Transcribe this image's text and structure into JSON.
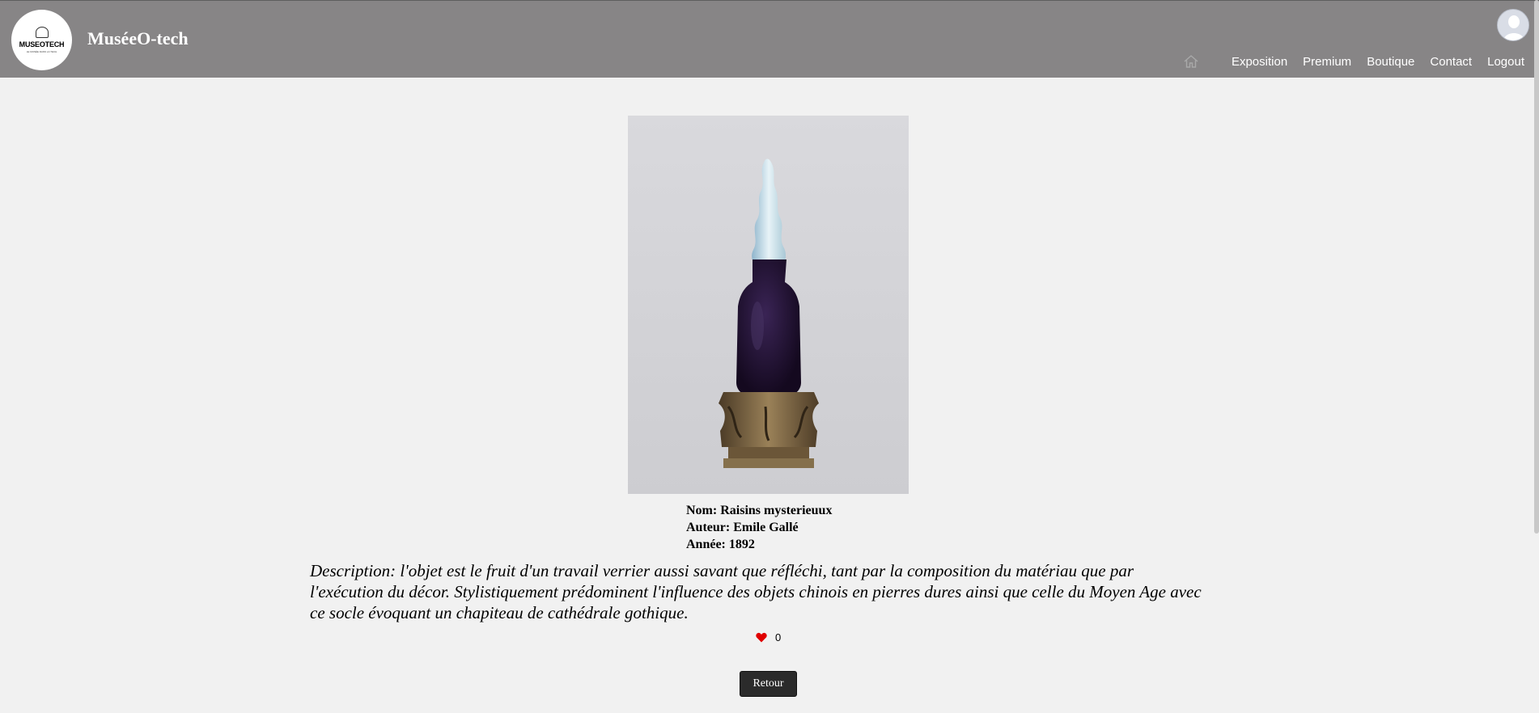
{
  "header": {
    "logo": {
      "text": "MUSEOTECH",
      "subtext": "LE MUSÉE DANS LA TECH"
    },
    "site_title": "MuséeO-tech",
    "nav": {
      "home_icon": "home-icon",
      "items": [
        {
          "label": "Exposition"
        },
        {
          "label": "Premium"
        },
        {
          "label": "Boutique"
        },
        {
          "label": "Contact"
        },
        {
          "label": "Logout"
        }
      ]
    },
    "avatar_icon": "user-avatar-icon"
  },
  "artwork": {
    "image_icon": "vase-artwork-image",
    "details": {
      "name": "Nom: Raisins mysterieuux",
      "author": "Auteur: Emile Gallé",
      "year": "Année: 1892"
    },
    "description": "Description: l'objet est le fruit d'un travail verrier aussi savant que réfléchi, tant par la composition du matériau que par l'exécution du décor. Stylistiquement prédominent l'influence des objets chinois en pierres dures ainsi que celle du Moyen Age avec ce socle évoquant un chapiteau de cathédrale gothique.",
    "likes": {
      "icon": "heart-icon",
      "count": "0",
      "color": "#e00000"
    }
  },
  "actions": {
    "back_label": "Retour"
  },
  "colors": {
    "header_bg": "#878586",
    "page_bg": "#f1f1f1",
    "button_bg": "#2b2b2b"
  }
}
